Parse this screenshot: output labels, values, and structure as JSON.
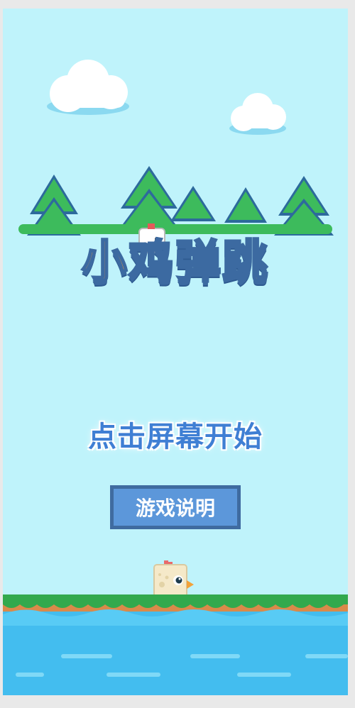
{
  "game": {
    "title": "小鸡弹跳",
    "start_prompt": "点击屏幕开始",
    "instructions_button": "游戏说明"
  },
  "colors": {
    "sky": "#bff3fb",
    "title_fill": "#ff9f2b",
    "title_outline": "#3c6aa1",
    "prompt_text": "#3f7fd4",
    "button_border": "#3f6ba0",
    "button_fill": "#5c97da",
    "grass": "#3cc45a",
    "dirt": "#d98a4a",
    "water": "#43bdef"
  },
  "icons": {
    "player": "chick-icon",
    "decoration": [
      "cloud-icon",
      "pine-tree-icon"
    ]
  }
}
